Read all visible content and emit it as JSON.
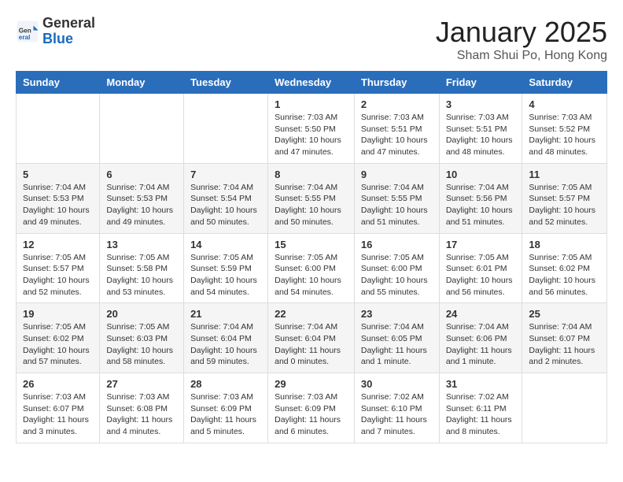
{
  "header": {
    "logo": {
      "line1": "General",
      "line2": "Blue"
    },
    "title": "January 2025",
    "location": "Sham Shui Po, Hong Kong"
  },
  "days_of_week": [
    "Sunday",
    "Monday",
    "Tuesday",
    "Wednesday",
    "Thursday",
    "Friday",
    "Saturday"
  ],
  "weeks": [
    {
      "cells": [
        {
          "day": "",
          "content": ""
        },
        {
          "day": "",
          "content": ""
        },
        {
          "day": "",
          "content": ""
        },
        {
          "day": "1",
          "content": "Sunrise: 7:03 AM\nSunset: 5:50 PM\nDaylight: 10 hours and 47 minutes."
        },
        {
          "day": "2",
          "content": "Sunrise: 7:03 AM\nSunset: 5:51 PM\nDaylight: 10 hours and 47 minutes."
        },
        {
          "day": "3",
          "content": "Sunrise: 7:03 AM\nSunset: 5:51 PM\nDaylight: 10 hours and 48 minutes."
        },
        {
          "day": "4",
          "content": "Sunrise: 7:03 AM\nSunset: 5:52 PM\nDaylight: 10 hours and 48 minutes."
        }
      ]
    },
    {
      "cells": [
        {
          "day": "5",
          "content": "Sunrise: 7:04 AM\nSunset: 5:53 PM\nDaylight: 10 hours and 49 minutes."
        },
        {
          "day": "6",
          "content": "Sunrise: 7:04 AM\nSunset: 5:53 PM\nDaylight: 10 hours and 49 minutes."
        },
        {
          "day": "7",
          "content": "Sunrise: 7:04 AM\nSunset: 5:54 PM\nDaylight: 10 hours and 50 minutes."
        },
        {
          "day": "8",
          "content": "Sunrise: 7:04 AM\nSunset: 5:55 PM\nDaylight: 10 hours and 50 minutes."
        },
        {
          "day": "9",
          "content": "Sunrise: 7:04 AM\nSunset: 5:55 PM\nDaylight: 10 hours and 51 minutes."
        },
        {
          "day": "10",
          "content": "Sunrise: 7:04 AM\nSunset: 5:56 PM\nDaylight: 10 hours and 51 minutes."
        },
        {
          "day": "11",
          "content": "Sunrise: 7:05 AM\nSunset: 5:57 PM\nDaylight: 10 hours and 52 minutes."
        }
      ]
    },
    {
      "cells": [
        {
          "day": "12",
          "content": "Sunrise: 7:05 AM\nSunset: 5:57 PM\nDaylight: 10 hours and 52 minutes."
        },
        {
          "day": "13",
          "content": "Sunrise: 7:05 AM\nSunset: 5:58 PM\nDaylight: 10 hours and 53 minutes."
        },
        {
          "day": "14",
          "content": "Sunrise: 7:05 AM\nSunset: 5:59 PM\nDaylight: 10 hours and 54 minutes."
        },
        {
          "day": "15",
          "content": "Sunrise: 7:05 AM\nSunset: 6:00 PM\nDaylight: 10 hours and 54 minutes."
        },
        {
          "day": "16",
          "content": "Sunrise: 7:05 AM\nSunset: 6:00 PM\nDaylight: 10 hours and 55 minutes."
        },
        {
          "day": "17",
          "content": "Sunrise: 7:05 AM\nSunset: 6:01 PM\nDaylight: 10 hours and 56 minutes."
        },
        {
          "day": "18",
          "content": "Sunrise: 7:05 AM\nSunset: 6:02 PM\nDaylight: 10 hours and 56 minutes."
        }
      ]
    },
    {
      "cells": [
        {
          "day": "19",
          "content": "Sunrise: 7:05 AM\nSunset: 6:02 PM\nDaylight: 10 hours and 57 minutes."
        },
        {
          "day": "20",
          "content": "Sunrise: 7:05 AM\nSunset: 6:03 PM\nDaylight: 10 hours and 58 minutes."
        },
        {
          "day": "21",
          "content": "Sunrise: 7:04 AM\nSunset: 6:04 PM\nDaylight: 10 hours and 59 minutes."
        },
        {
          "day": "22",
          "content": "Sunrise: 7:04 AM\nSunset: 6:04 PM\nDaylight: 11 hours and 0 minutes."
        },
        {
          "day": "23",
          "content": "Sunrise: 7:04 AM\nSunset: 6:05 PM\nDaylight: 11 hours and 1 minute."
        },
        {
          "day": "24",
          "content": "Sunrise: 7:04 AM\nSunset: 6:06 PM\nDaylight: 11 hours and 1 minute."
        },
        {
          "day": "25",
          "content": "Sunrise: 7:04 AM\nSunset: 6:07 PM\nDaylight: 11 hours and 2 minutes."
        }
      ]
    },
    {
      "cells": [
        {
          "day": "26",
          "content": "Sunrise: 7:03 AM\nSunset: 6:07 PM\nDaylight: 11 hours and 3 minutes."
        },
        {
          "day": "27",
          "content": "Sunrise: 7:03 AM\nSunset: 6:08 PM\nDaylight: 11 hours and 4 minutes."
        },
        {
          "day": "28",
          "content": "Sunrise: 7:03 AM\nSunset: 6:09 PM\nDaylight: 11 hours and 5 minutes."
        },
        {
          "day": "29",
          "content": "Sunrise: 7:03 AM\nSunset: 6:09 PM\nDaylight: 11 hours and 6 minutes."
        },
        {
          "day": "30",
          "content": "Sunrise: 7:02 AM\nSunset: 6:10 PM\nDaylight: 11 hours and 7 minutes."
        },
        {
          "day": "31",
          "content": "Sunrise: 7:02 AM\nSunset: 6:11 PM\nDaylight: 11 hours and 8 minutes."
        },
        {
          "day": "",
          "content": ""
        }
      ]
    }
  ]
}
